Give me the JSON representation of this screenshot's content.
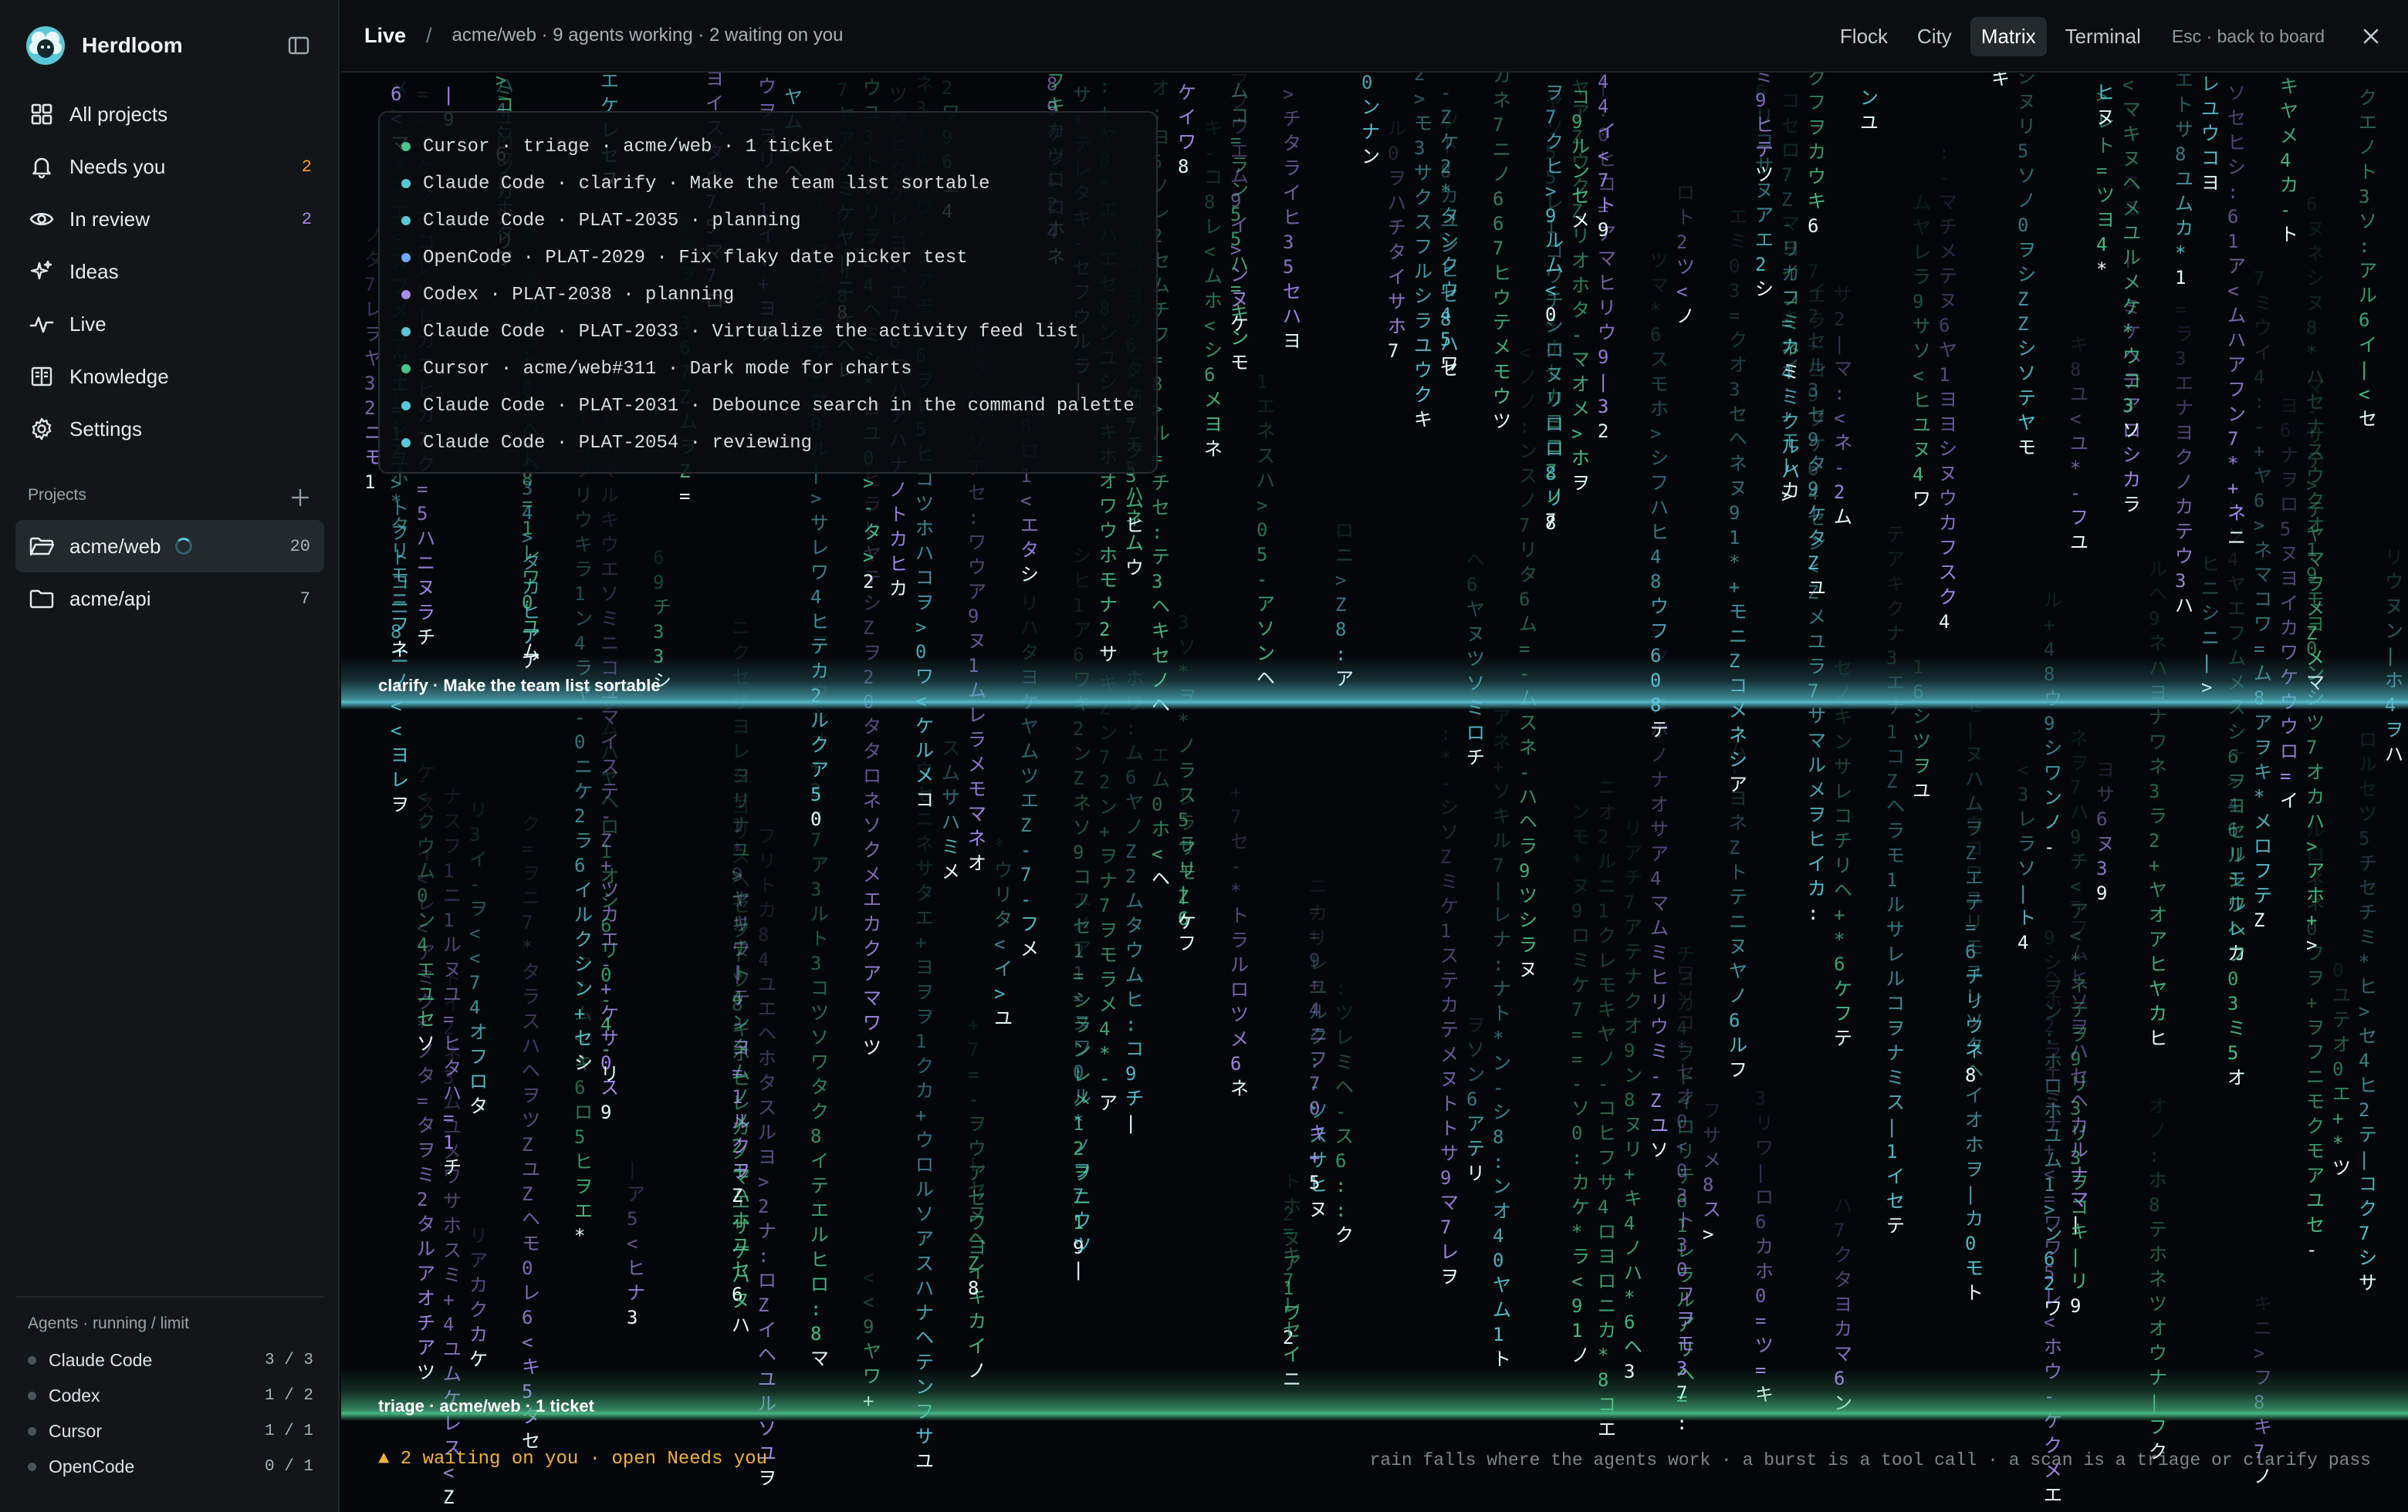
{
  "app": {
    "name": "Herdloom"
  },
  "sidebar": {
    "nav": [
      {
        "label": "All projects",
        "icon": "grid-icon",
        "badge": ""
      },
      {
        "label": "Needs you",
        "icon": "bell-icon",
        "badge": "2"
      },
      {
        "label": "In review",
        "icon": "eye-icon",
        "badge": "2"
      },
      {
        "label": "Ideas",
        "icon": "sparkles-icon",
        "badge": ""
      },
      {
        "label": "Live",
        "icon": "pulse-icon",
        "badge": ""
      },
      {
        "label": "Knowledge",
        "icon": "book-icon",
        "badge": ""
      },
      {
        "label": "Settings",
        "icon": "gear-icon",
        "badge": ""
      }
    ],
    "projects_label": "Projects",
    "projects": [
      {
        "name": "acme/web",
        "count": "20",
        "active": true
      },
      {
        "name": "acme/api",
        "count": "7",
        "active": false
      }
    ],
    "agents_label": "Agents · running / limit",
    "agents": [
      {
        "name": "Claude Code",
        "limit": "3 / 3"
      },
      {
        "name": "Codex",
        "limit": "1 / 2"
      },
      {
        "name": "Cursor",
        "limit": "1 / 1"
      },
      {
        "name": "OpenCode",
        "limit": "0 / 1"
      }
    ]
  },
  "topbar": {
    "live": "Live",
    "sep": "/",
    "desc": "acme/web · 9 agents working · 2 waiting on you",
    "views": [
      "Flock",
      "City",
      "Matrix",
      "Terminal"
    ],
    "active_view": "Matrix",
    "esc_hint": "Esc · back to board"
  },
  "tickets": [
    {
      "text": "Cursor · triage · acme/web · 1 ticket",
      "color": "#4cc38a"
    },
    {
      "text": "Claude Code · clarify · Make the team list sortable",
      "color": "#5bc8d8"
    },
    {
      "text": "Claude Code · PLAT-2035 · planning",
      "color": "#5bc8d8"
    },
    {
      "text": "OpenCode · PLAT-2029 · Fix flaky date picker test",
      "color": "#6fa8ff"
    },
    {
      "text": "Codex · PLAT-2038 · planning",
      "color": "#a98cf0"
    },
    {
      "text": "Claude Code · PLAT-2033 · Virtualize the activity feed list",
      "color": "#5bc8d8"
    },
    {
      "text": "Cursor · acme/web#311 · Dark mode for charts",
      "color": "#4cc38a"
    },
    {
      "text": "Claude Code · PLAT-2031 · Debounce search in the command palette",
      "color": "#5bc8d8"
    },
    {
      "text": "Claude Code · PLAT-2054 · reviewing",
      "color": "#5bc8d8"
    }
  ],
  "scans": [
    {
      "label": "clarify · Make the team list sortable",
      "color": "#5bc8d8"
    },
    {
      "label": "triage · acme/web · 1 ticket",
      "color": "#4cc38a"
    }
  ],
  "footer": {
    "warning": "▲ 2 waiting on you · open Needs you",
    "hint": "rain falls where the agents work · a burst is a tool call · a scan is a triage or clarify pass"
  },
  "rain_colors": [
    "#5bc8d8",
    "#4cc38a",
    "#a98cf0"
  ]
}
